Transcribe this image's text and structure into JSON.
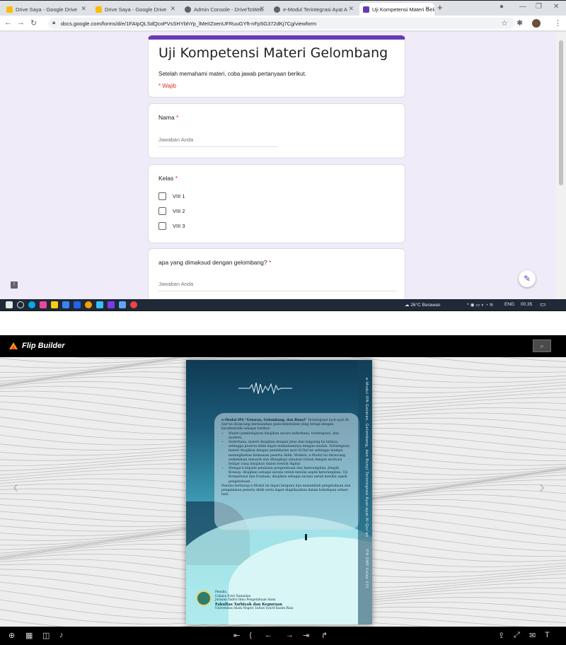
{
  "browser": {
    "tabs": [
      {
        "title": "Drive Saya - Google Drive",
        "favicon_color": "#fbbc04"
      },
      {
        "title": "Drive Saya - Google Drive",
        "favicon_color": "#fbbc04"
      },
      {
        "title": "Admin Console - DriveToWeb",
        "favicon_color": "#5f6368"
      },
      {
        "title": "e-Modul Terintegrasi Ayat A",
        "favicon_color": "#5f6368"
      },
      {
        "title": "Uji Kompetensi Materi Gelom",
        "favicon_color": "#673ab7",
        "active": true
      }
    ],
    "close_glyph": "✕",
    "new_tab": "+",
    "url": "docs.google.com/forms/d/e/1FAIpQLSdQcoPVsSHYbhYp_lMeIIZxenUFRuuGYft-nFp5G372dKj7Cg/viewform",
    "icons": {
      "back": "back-arrow-icon",
      "forward": "forward-arrow-icon",
      "reload": "reload-icon",
      "lock": "lock-icon",
      "star": "star-icon",
      "extensions": "extensions-icon",
      "menu": "menu-dots-icon"
    }
  },
  "form": {
    "title": "Uji Kompetensi Materi Gelombang",
    "description": "Setelah memahami materi, coba jawab pertanyaan berikut.",
    "required_note": "* Wajib",
    "accent_color": "#673ab7",
    "questions": {
      "nama": {
        "label": "Nama",
        "required_mark": "*",
        "placeholder": "Jawaban Anda"
      },
      "kelas": {
        "label": "Kelas",
        "required_mark": "*",
        "options": [
          "VIII 1",
          "VIII 2",
          "VIII 3"
        ]
      },
      "gelombang": {
        "label": "apa yang dimaksud dengan gelombang?",
        "required_mark": "*",
        "placeholder": "Jawaban Anda"
      }
    }
  },
  "taskbar": {
    "weather": "26°C  Berawan",
    "language": "ENG",
    "time": "00.35"
  },
  "flipbook": {
    "app_name": "Flip Builder",
    "back_cover": {
      "spine_text": "e-Modul IPA Getaran, Gelombang, dan Bunyi Terintegrasi Ayat-ayat Al-Qur'an",
      "spine_footer": "IPA SMP Kelas VIII",
      "blurb_intro_bold": "e-Modul IPA \"Getaran, Gelombang, dan Bunyi\"",
      "blurb_intro": "Terintegrasi ayat-ayat Al-Qur'an dirancang berdasarkan pada kebutuhan yang tersaji dengan karakteristik sebagai berikut:",
      "bullets": [
        "Materi pembelajaran disajikan secara sederhana, terintegrasi, dan modern.",
        "Sederhana, materi disajikan dengan jelas dan langsung ke intinya, sehingga peserta didik dapat memahaminya dengan mudah. Terintegrasi, materi disajikan dengan pendekatan ayat Al-Qur'an sehingga mampu meningkatkan keimanan peserta didik. Modern, e-Modul ini dirancang sedemikian menarik dan dilengkapi simulasi virtual dengan motivasi belajar yang disajikan dalam bentuk digital.",
        "Mengacu kepada penilaian pengetahuan dan keterampilan. Jelajah Konsep, disajikan sebagai sarana untuk menilai aspek keterampilan, Uji Kompetensi dan Evaluasi, disajikan sebagai sarana untuk menilai aspek pengetahuan."
      ],
      "closing": "Penulis berharap e-Modul ini dapat berguna dan menambah pengetahuan dan pengalaman peserta didik serta dapat diaplikasikan dalam kehidupan sehari-hari.",
      "publisher_label": "Penulis,",
      "author": "Cahaya Putri Ramadan",
      "department": "Jurusan Tadris Ilmu Pengetahuan Alam",
      "faculty": "Fakultas Tarbiyah dan Keguruan",
      "university": "Universitas Islam Negeri Sultan Syarif Kasim Riau"
    },
    "icons": {
      "search": "search-icon",
      "zoom": "zoom-icon",
      "thumbnails": "thumbnails-icon",
      "single_page": "single-page-icon",
      "sound": "sound-icon",
      "first": "first-page-icon",
      "prev": "previous-page-icon",
      "next": "next-page-icon",
      "last": "last-page-icon",
      "share": "share-icon",
      "fullscreen": "fullscreen-icon",
      "mail": "mail-icon",
      "text": "text-icon"
    }
  }
}
